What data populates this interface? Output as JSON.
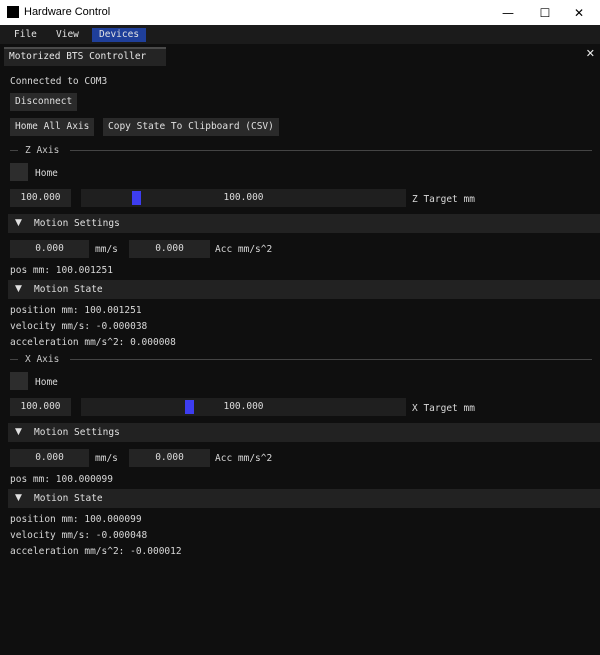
{
  "window": {
    "title": "Hardware Control",
    "minimize_glyph": "—",
    "maximize_glyph": "☐",
    "close_glyph": "✕"
  },
  "menu": [
    "File",
    "View",
    "Devices"
  ],
  "tab": {
    "label": "Motorized BTS Controller",
    "close_glyph": "✕"
  },
  "status": {
    "connected": "Connected to COM3"
  },
  "buttons": {
    "disconnect": "Disconnect",
    "home_all": "Home All Axis",
    "copy_state": "Copy State To Clipboard (CSV)"
  },
  "axes": [
    {
      "title": "Z Axis",
      "home_label": "Home",
      "target_input": "100.000",
      "slider_value": "100.000",
      "slider_fraction": 0.16,
      "target_label": "Z Target mm",
      "motion_settings": "Motion Settings",
      "velocity_value": "0.000",
      "velocity_unit": "mm/s",
      "acc_value": "0.000",
      "acc_unit": "Acc mm/s^2",
      "pos": "pos mm: 100.001251",
      "motion_state": "Motion State",
      "position": "position mm: 100.001251",
      "velocity": "velocity mm/s: -0.000038",
      "acceleration": "acceleration mm/s^2: 0.000008",
      "header_arrow": "▼"
    },
    {
      "title": "X Axis",
      "home_label": "Home",
      "target_input": "100.000",
      "slider_value": "100.000",
      "slider_fraction": 0.33,
      "target_label": "X Target mm",
      "motion_settings": "Motion Settings",
      "velocity_value": "0.000",
      "velocity_unit": "mm/s",
      "acc_value": "0.000",
      "acc_unit": "Acc mm/s^2",
      "pos": "pos mm: 100.000099",
      "motion_state": "Motion State",
      "position": "position mm: 100.000099",
      "velocity": "velocity mm/s: -0.000048",
      "acceleration": "acceleration mm/s^2: -0.000012",
      "header_arrow": "▼"
    }
  ],
  "colors": {
    "background": "#0f0f0f",
    "accent": "#3d3df0",
    "connected": "#3bd63b",
    "menu_active": "#1f3f9a"
  }
}
